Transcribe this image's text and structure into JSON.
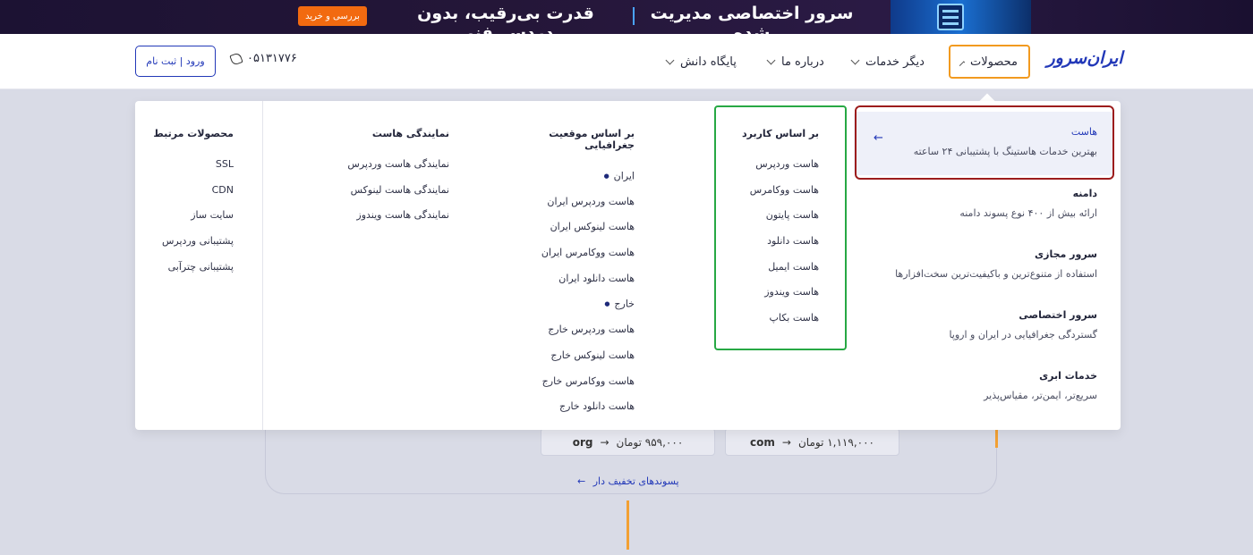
{
  "banner": {
    "cta": "بررسی و خرید",
    "text_left": "قدرت بی‌رقیب، بدون دردسر فنی",
    "text_right": "سرور اختصاصی مدیریت شده"
  },
  "header": {
    "logo": "ایران‌سرور",
    "nav": [
      {
        "label": "محصولات"
      },
      {
        "label": "دیگر خدمات"
      },
      {
        "label": "درباره ما"
      },
      {
        "label": "پایگاه دانش"
      }
    ],
    "phone": "۰۵۱۳۱۷۷۶",
    "login": "ورود | ثبت نام"
  },
  "menu": {
    "categories": [
      {
        "title": "هاست",
        "desc": "بهترین خدمات هاستینگ با پشتیبانی ۲۴ ساعته"
      },
      {
        "title": "دامنه",
        "desc": "ارائه بیش از ۴۰۰ نوع پسوند دامنه"
      },
      {
        "title": "سرور مجازی",
        "desc": "استفاده از متنوع‌ترین و باکیفیت‌ترین سخت‌افزارها"
      },
      {
        "title": "سرور اختصاصی",
        "desc": "گستردگی جغرافیایی در ایران و اروپا"
      },
      {
        "title": "خدمات ابری",
        "desc": "سریع‌تر، ایمن‌تر، مقیاس‌پذیر"
      }
    ],
    "by_use": {
      "head": "بر اساس کاربرد",
      "items": [
        "هاست وردپرس",
        "هاست ووکامرس",
        "هاست پایتون",
        "هاست دانلود",
        "هاست ایمیل",
        "هاست ویندوز",
        "هاست بکاپ"
      ]
    },
    "by_location": {
      "head": "بر اساس موقعیت جغرافیایی",
      "items": [
        "ایران",
        "هاست وردپرس ایران",
        "هاست لینوکس ایران",
        "هاست ووکامرس ایران",
        "هاست دانلود ایران",
        "خارج",
        "هاست وردپرس خارج",
        "هاست لینوکس خارج",
        "هاست ووکامرس خارج",
        "هاست دانلود خارج"
      ]
    },
    "reseller": {
      "head": "نمایندگی هاست",
      "items": [
        "نمایندگی هاست وردپرس",
        "نمایندگی هاست لینوکس",
        "نمایندگی هاست ویندوز"
      ]
    },
    "related": {
      "head": "محصولات مرتبط",
      "items": [
        "SSL",
        "CDN",
        "سایت ساز",
        "پشتیبانی وردپرس",
        "پشتیبانی چترآبی"
      ]
    }
  },
  "background": {
    "domain_boxes": [
      {
        "ext": "org",
        "price": "۹۵۹,۰۰۰ تومان"
      },
      {
        "ext": "com",
        "price": "۱,۱۱۹,۰۰۰ تومان"
      }
    ],
    "discount_link": "پسوندهای تخفیف دار"
  }
}
